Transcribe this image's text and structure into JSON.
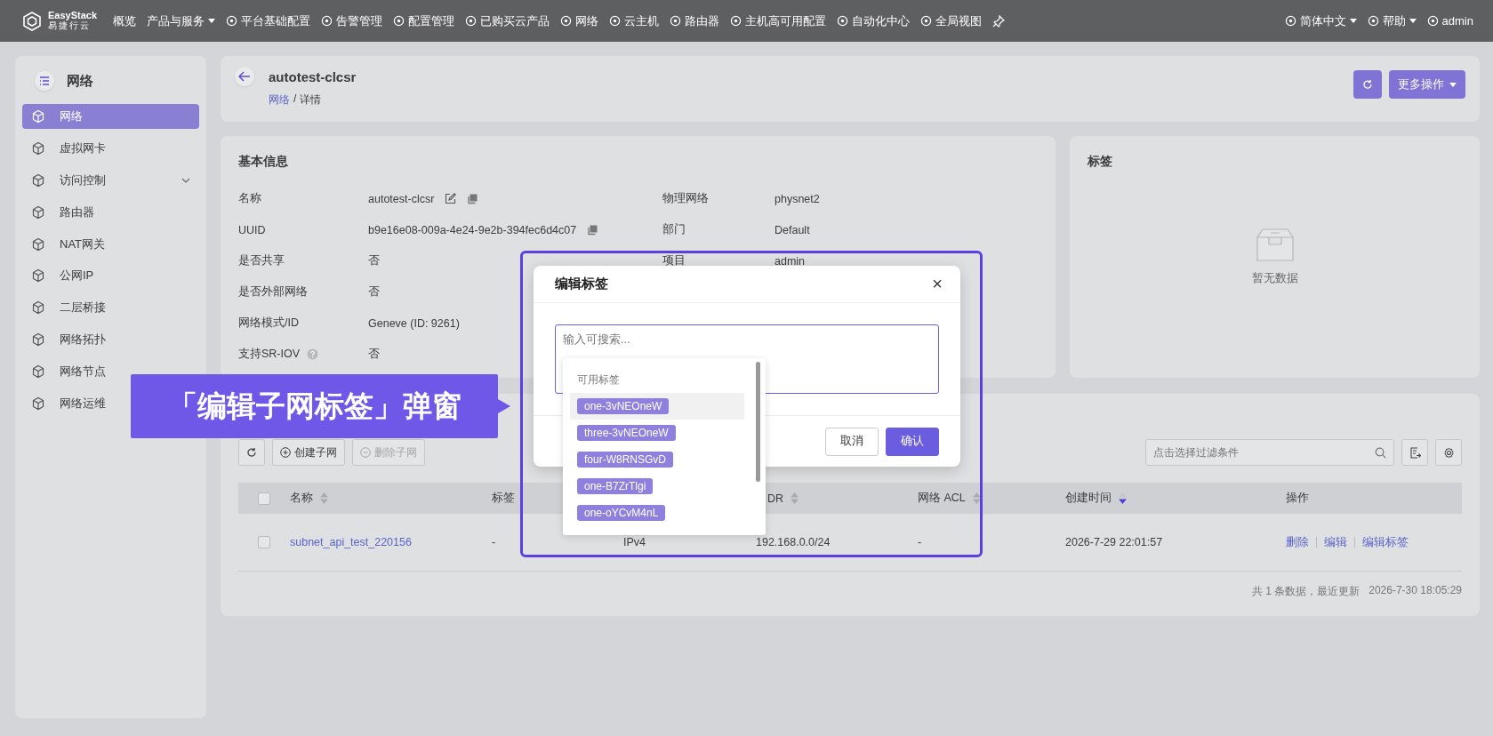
{
  "top_nav": {
    "logo_text": "EasyStack",
    "logo_subtext": "易捷行云",
    "items": [
      {
        "label": "概览",
        "kind": "plain"
      },
      {
        "label": "产品与服务",
        "kind": "dropdown"
      },
      {
        "label": "平台基础配置",
        "kind": "icon"
      },
      {
        "label": "告警管理",
        "kind": "icon"
      },
      {
        "label": "配置管理",
        "kind": "icon"
      },
      {
        "label": "已购买云产品",
        "kind": "icon"
      },
      {
        "label": "网络",
        "kind": "icon"
      },
      {
        "label": "云主机",
        "kind": "icon"
      },
      {
        "label": "路由器",
        "kind": "icon"
      },
      {
        "label": "主机高可用配置",
        "kind": "icon"
      },
      {
        "label": "自动化中心",
        "kind": "icon"
      },
      {
        "label": "全局视图",
        "kind": "icon"
      }
    ],
    "right": [
      {
        "label": "简体中文"
      },
      {
        "label": "帮助"
      },
      {
        "label": "admin"
      }
    ]
  },
  "sidebar": {
    "title": "网络",
    "items": [
      {
        "label": "网络",
        "selected": true
      },
      {
        "label": "虚拟网卡",
        "selected": false
      },
      {
        "label": "访问控制",
        "selected": false,
        "expanded": false
      },
      {
        "label": "路由器",
        "selected": false
      },
      {
        "label": "NAT网关",
        "selected": false
      },
      {
        "label": "公网IP",
        "selected": false
      },
      {
        "label": "二层桥接",
        "selected": false
      },
      {
        "label": "网络拓扑",
        "selected": false
      },
      {
        "label": "网络节点",
        "selected": false
      },
      {
        "label": "网络运维",
        "selected": false
      }
    ]
  },
  "header": {
    "title": "autotest-clcsr",
    "breadcrumb": [
      {
        "label": "网络",
        "kind": "link"
      },
      {
        "label": "/",
        "kind": "separator"
      },
      {
        "label": "详情",
        "kind": "current"
      }
    ],
    "more_button": "更多操作"
  },
  "basic_info": {
    "title": "基本信息",
    "left": [
      {
        "label": "名称",
        "value": "autotest-clcsr",
        "editable": true,
        "copyable": true
      },
      {
        "label": "UUID",
        "value": "b9e16e08-009a-4e24-9e2b-394fec6d4c07",
        "copyable": true
      },
      {
        "label": "是否共享",
        "value": "否"
      },
      {
        "label": "是否外部网络",
        "value": "否"
      },
      {
        "label": "网络模式/ID",
        "value": "Geneve (ID: 9261)"
      },
      {
        "label": "支持SR-IOV",
        "value": "否",
        "help": true
      }
    ],
    "right": [
      {
        "label": "物理网络",
        "value": "physnet2"
      },
      {
        "label": "部门",
        "value": "Default"
      },
      {
        "label": "项目",
        "value": "admin"
      }
    ]
  },
  "tags_card": {
    "title": "标签",
    "empty_text": "暂无数据"
  },
  "subnets": {
    "toolbar": {
      "create": {
        "label": "创建子网",
        "disabled": false
      },
      "delete": {
        "label": "删除子网",
        "disabled": true
      },
      "filter_placeholder": "点击选择过滤条件"
    },
    "columns": [
      {
        "label": "名称",
        "sortable": true,
        "sort_desc": false
      },
      {
        "label": "标签"
      },
      {},
      {
        "label": "DR",
        "sortable": true,
        "sort_desc": false
      },
      {
        "label": "网络 ACL",
        "sortable": true,
        "sort_desc": false
      },
      {
        "label": "创建时间",
        "sortable": true,
        "sort_desc": true
      },
      {
        "label": "操作"
      }
    ],
    "header_checked": false,
    "rows": [
      {
        "checked": false,
        "cells": [
          "subnet_api_test_220156",
          "-",
          "IPv4",
          "192.168.0.0/24",
          "-",
          "2026-7-29 22:01:57"
        ],
        "actions": [
          "删除",
          "编辑",
          "编辑标签"
        ]
      }
    ],
    "footer": {
      "count": "共 1 条数据，最近更新",
      "updated": "2026-7-30 18:05:29"
    }
  },
  "modal": {
    "title": "编辑标签",
    "close": "×",
    "placeholder": "输入可搜索...",
    "buttons": [
      {
        "label": "取消",
        "kind": "default"
      },
      {
        "label": "确认",
        "kind": "primary"
      }
    ],
    "dropdown": {
      "header": "可用标签",
      "options": [
        {
          "label": "one-3vNEOneW",
          "selected": true
        },
        {
          "label": "three-3vNEOneW",
          "selected": false
        },
        {
          "label": "four-W8RNSGvD",
          "selected": false
        },
        {
          "label": "one-B7ZrTlgi",
          "selected": false
        },
        {
          "label": "one-oYCvM4nL",
          "selected": false
        }
      ]
    }
  },
  "callout": {
    "text": "「编辑子网标签」弹窗"
  }
}
